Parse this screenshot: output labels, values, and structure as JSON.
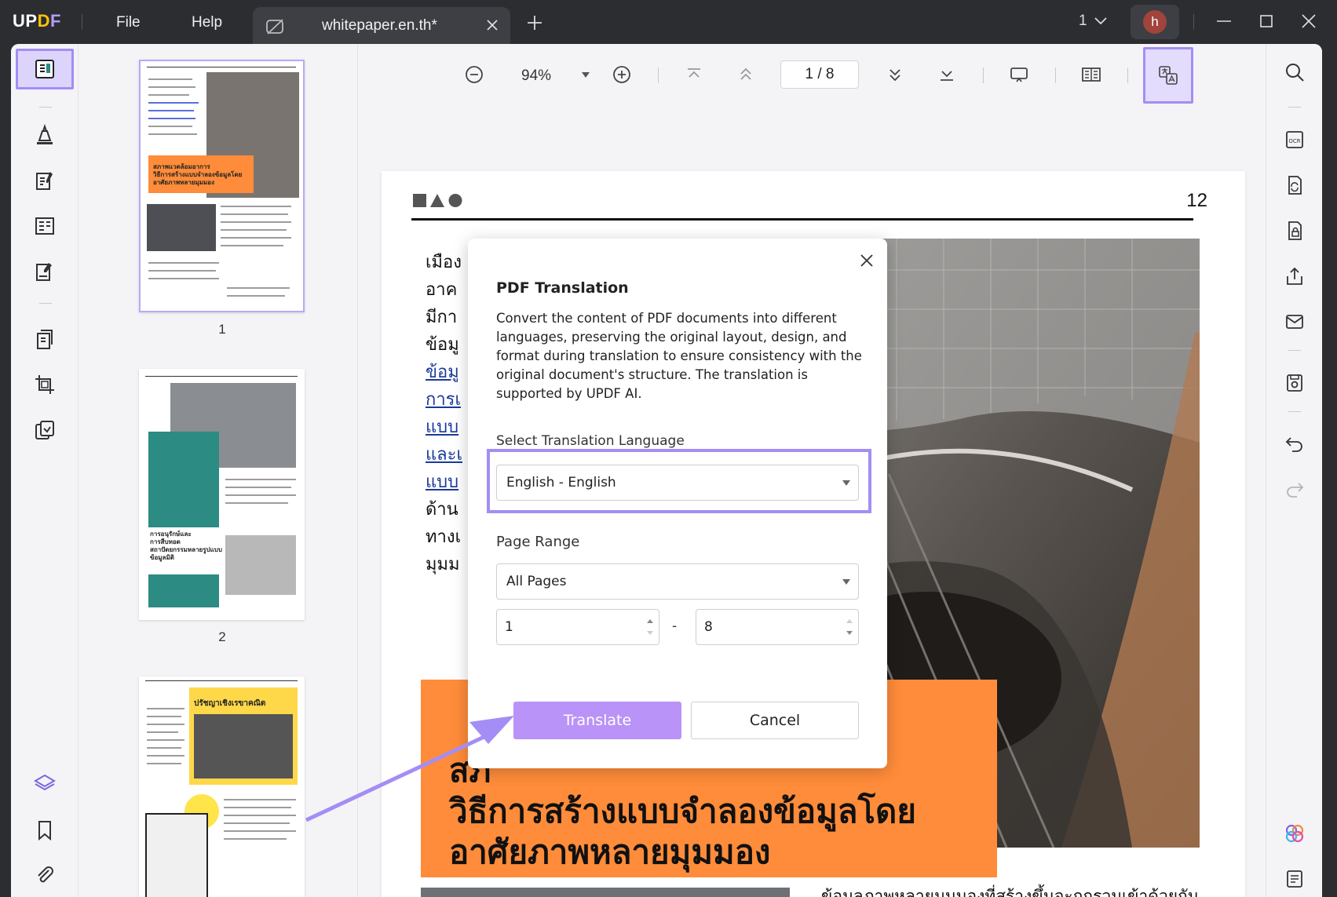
{
  "app": {
    "logo_u": "UP",
    "logo_d": "D",
    "logo_f": "F",
    "menu_file": "File",
    "menu_help": "Help",
    "tab_title": "whitepaper.en.th*",
    "page_count": "1",
    "avatar_initial": "h"
  },
  "toolbar": {
    "zoom": "94%",
    "page_indicator": "1  /  8"
  },
  "thumbnails": [
    {
      "number": "1",
      "label": "สภาพแวดล้อมอาการ\nวิธีการสร้างแบบจำลองข้อมูลโดย\nอาศัยภาพหลายมุมมอง"
    },
    {
      "number": "2",
      "label": "การอนุรักษ์และ\nการสืบทอด\nสถาปัตยกรรมหลายรูปแบบ\nข้อมูลมิติ"
    },
    {
      "number": "",
      "label": "ปรัชญาเชิงเรขาคณิต"
    }
  ],
  "document": {
    "page_number": "12",
    "left_lines": [
      "เมือง",
      "อาค",
      "มีกา",
      "ข้อมู",
      "ข้อมู",
      "การเ",
      "แบบ",
      "และเ",
      "แบบ",
      "ด้าน",
      "ทางเ",
      "มุมม"
    ],
    "orange_title": "สภ\nวิธีการสร้างแบบจำลองข้อมูลโดย\nอาศัยภาพหลายมุมมอง",
    "bottom_text": "ข้อมูลภาพหลายมุมมองที่สร้างขึ้นจะถูกรวมเข้าด้วยกัน\nและภาพถ่ายพื้นดินและภาพทางอากาศจะถูกรวมเข้าด้วย"
  },
  "dialog": {
    "title": "PDF Translation",
    "description": "Convert the content of PDF documents into different languages, preserving the original layout, design, and format during translation to ensure consistency with the original document's structure. The translation is supported by UPDF AI.",
    "language_label": "Select Translation Language",
    "language_value": "English - English",
    "range_label": "Page Range",
    "range_value": "All Pages",
    "range_from": "1",
    "range_dash": "-",
    "range_to": "8",
    "translate_label": "Translate",
    "cancel_label": "Cancel"
  },
  "colors": {
    "accent": "#a48df5",
    "translate_button": "#b993f7",
    "orange": "#ff8c3a",
    "teal": "#2c8b83"
  }
}
